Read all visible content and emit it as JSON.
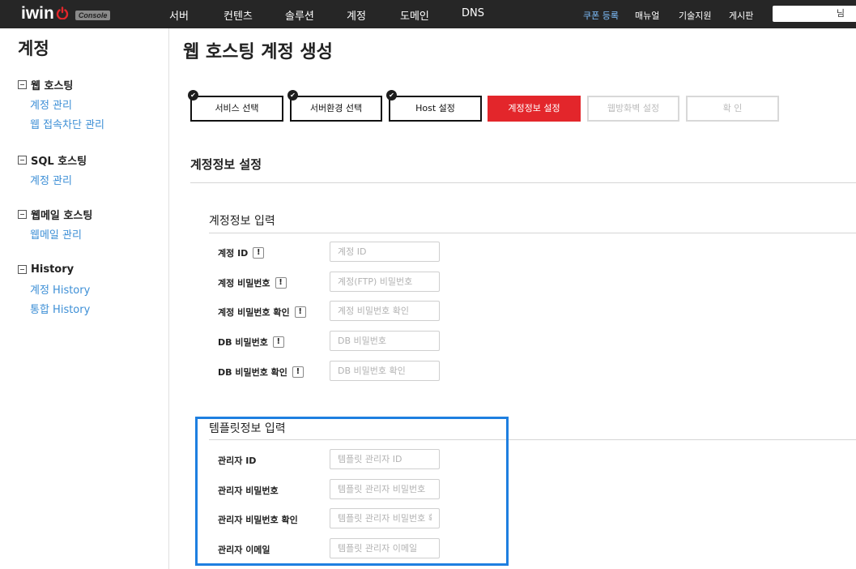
{
  "header": {
    "logo_text": "iwin",
    "logo_badge": "Console",
    "nav": [
      "서버",
      "컨텐츠",
      "솔루션",
      "계정",
      "도메인",
      "DNS"
    ],
    "util": [
      "쿠폰 등록",
      "매뉴얼",
      "기술지원",
      "게시판"
    ],
    "user_suffix": "님",
    "accent_color": "#7fc0ff"
  },
  "sidebar": {
    "title": "계정",
    "groups": [
      {
        "label": "웹 호스팅",
        "links": [
          "계정 관리",
          "웹 접속차단 관리"
        ]
      },
      {
        "label": "SQL 호스팅",
        "links": [
          "계정 관리"
        ]
      },
      {
        "label": "웹메일 호스팅",
        "links": [
          "웹메일 관리"
        ]
      },
      {
        "label": "History",
        "links": [
          "계정 History",
          "통합 History"
        ]
      }
    ],
    "link_color": "#3d8fd6"
  },
  "main": {
    "title": "웹 호스팅 계정 생성",
    "steps": [
      {
        "label": "서비스 선택",
        "state": "done"
      },
      {
        "label": "서버환경 선택",
        "state": "done"
      },
      {
        "label": "Host 설정",
        "state": "done"
      },
      {
        "label": "계정정보 설정",
        "state": "active"
      },
      {
        "label": "웹방화벽 설정",
        "state": "pending"
      },
      {
        "label": "확 인",
        "state": "pending"
      }
    ],
    "active_color": "#e3262b",
    "section_title": "계정정보 설정",
    "account": {
      "title": "계정정보 입력",
      "fields": [
        {
          "label": "계정 ID",
          "info": "!",
          "placeholder": "계정 ID"
        },
        {
          "label": "계정 비밀번호",
          "info": "!",
          "placeholder": "계정(FTP) 비밀번호"
        },
        {
          "label": "계정 비밀번호 확인",
          "info": "!",
          "placeholder": "계정 비밀번호 확인"
        },
        {
          "label": "DB 비밀번호",
          "info": "!",
          "placeholder": "DB 비밀번호"
        },
        {
          "label": "DB 비밀번호 확인",
          "info": "!",
          "placeholder": "DB 비밀번호 확인"
        }
      ]
    },
    "template": {
      "title": "템플릿정보 입력",
      "fields": [
        {
          "label": "관리자 ID",
          "placeholder": "템플릿 관리자 ID"
        },
        {
          "label": "관리자 비밀번호",
          "placeholder": "템플릿 관리자 비밀번호"
        },
        {
          "label": "관리자 비밀번호 확인",
          "placeholder": "템플릿 관리자 비밀번호 확인"
        },
        {
          "label": "관리자 이메일",
          "placeholder": "템플릿 관리자 이메일"
        }
      ]
    },
    "highlight_color": "#1e7fe0"
  }
}
